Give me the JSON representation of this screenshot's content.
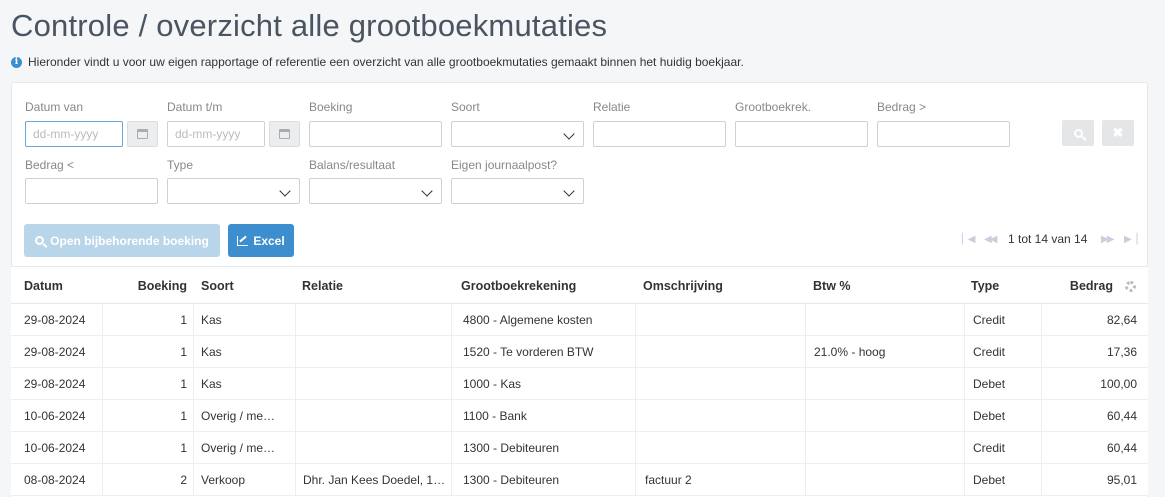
{
  "page": {
    "title": "Controle / overzicht alle grootboekmutaties",
    "info": "Hieronder vindt u voor uw eigen rapportage of referentie een overzicht van alle grootboekmutaties gemaakt binnen het huidig boekjaar."
  },
  "filters": {
    "datum_van": {
      "label": "Datum van",
      "placeholder": "dd-mm-yyyy"
    },
    "datum_tm": {
      "label": "Datum t/m",
      "placeholder": "dd-mm-yyyy"
    },
    "boeking": {
      "label": "Boeking"
    },
    "soort": {
      "label": "Soort"
    },
    "relatie": {
      "label": "Relatie"
    },
    "grootboekrek": {
      "label": "Grootboekrek."
    },
    "bedrag_gt": {
      "label": "Bedrag >"
    },
    "bedrag_lt": {
      "label": "Bedrag <"
    },
    "type": {
      "label": "Type"
    },
    "balans_resultaat": {
      "label": "Balans/resultaat"
    },
    "eigen_journaalpost": {
      "label": "Eigen journaalpost?"
    }
  },
  "actions": {
    "open_label": "Open bijbehorende boeking",
    "excel_label": "Excel"
  },
  "pager": {
    "text": "1 tot 14 van 14"
  },
  "table": {
    "headers": [
      "Datum",
      "Boeking",
      "Soort",
      "Relatie",
      "Grootboekrekening",
      "Omschrijving",
      "Btw %",
      "Type",
      "Bedrag"
    ],
    "rows": [
      [
        "29-08-2024",
        "1",
        "Kas",
        "",
        "4800 - Algemene kosten",
        "",
        "",
        "Credit",
        "82,64"
      ],
      [
        "29-08-2024",
        "1",
        "Kas",
        "",
        "1520 - Te vorderen BTW",
        "",
        "21.0% - hoog",
        "Credit",
        "17,36"
      ],
      [
        "29-08-2024",
        "1",
        "Kas",
        "",
        "1000 - Kas",
        "",
        "",
        "Debet",
        "100,00"
      ],
      [
        "10-06-2024",
        "1",
        "Overig / me…",
        "",
        "1100 - Bank",
        "",
        "",
        "Debet",
        "60,44"
      ],
      [
        "10-06-2024",
        "1",
        "Overig / me…",
        "",
        "1300 - Debiteuren",
        "",
        "",
        "Credit",
        "60,44"
      ],
      [
        "08-08-2024",
        "2",
        "Verkoop",
        "Dhr. Jan Kees Doedel, 1…",
        "1300 - Debiteuren",
        "factuur 2",
        "",
        "Debet",
        "95,01"
      ]
    ]
  },
  "colors": {
    "accent": "#3d8ecf",
    "title": "#4a5561"
  }
}
